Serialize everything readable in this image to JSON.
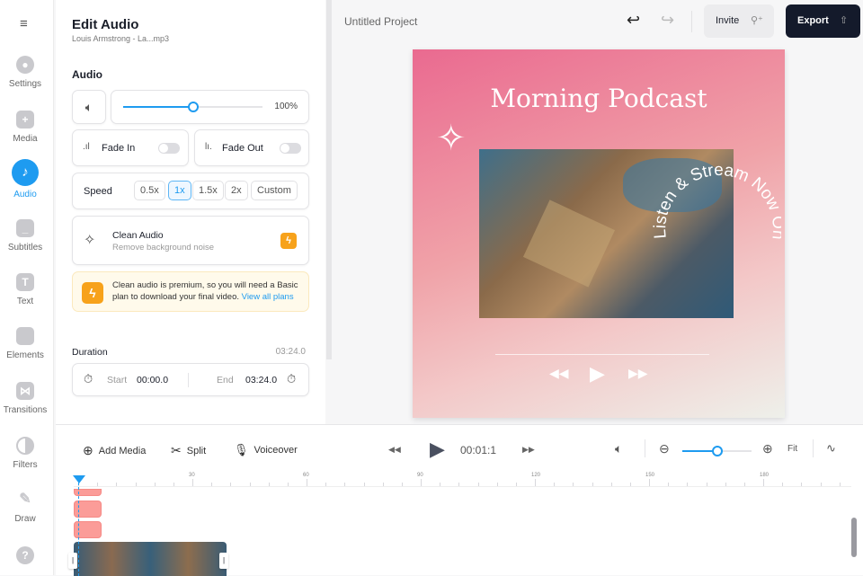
{
  "sidebar": {
    "items": [
      {
        "label": "Settings"
      },
      {
        "label": "Media"
      },
      {
        "label": "Audio"
      },
      {
        "label": "Subtitles"
      },
      {
        "label": "Text"
      },
      {
        "label": "Elements"
      },
      {
        "label": "Transitions"
      },
      {
        "label": "Filters"
      },
      {
        "label": "Draw"
      }
    ],
    "help": "?"
  },
  "panel": {
    "title": "Edit Audio",
    "subtitle": "Louis Armstrong - La...mp3",
    "section": "Audio",
    "volume": "100%",
    "volume_fraction": 0.5,
    "fade_in": "Fade In",
    "fade_out": "Fade Out",
    "speed_label": "Speed",
    "speeds": [
      "0.5x",
      "1x",
      "1.5x",
      "2x",
      "Custom"
    ],
    "clean_title": "Clean Audio",
    "clean_sub": "Remove background noise",
    "notice": "Clean audio is premium, so you will need a Basic plan to download your final video.",
    "notice_link": "View all plans",
    "duration_label": "Duration",
    "duration_total": "03:24.0",
    "start_label": "Start",
    "start": "00:00.0",
    "end_label": "End",
    "end": "03:24.0"
  },
  "header": {
    "project": "Untitled Project",
    "invite": "Invite",
    "export": "Export"
  },
  "canvas": {
    "title": "Morning Podcast",
    "curved": "Listen & Stream Now On"
  },
  "timeline": {
    "add_media": "Add Media",
    "split": "Split",
    "voiceover": "Voiceover",
    "time": "00:01:1",
    "fit": "Fit",
    "zoom_fraction": 0.5,
    "ticks": [
      "30",
      "60",
      "90",
      "120",
      "150",
      "180"
    ]
  }
}
